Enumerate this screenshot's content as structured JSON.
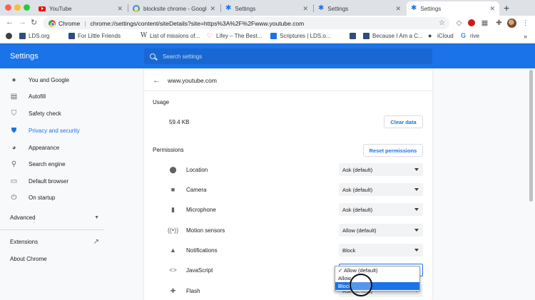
{
  "tabs": [
    {
      "label": "YouTube",
      "icon": "youtube-icon",
      "active": false
    },
    {
      "label": "blocksite chrome - Google S",
      "icon": "google-icon",
      "active": false
    },
    {
      "label": "Settings",
      "icon": "gear-icon",
      "active": false
    },
    {
      "label": "Settings",
      "icon": "gear-icon",
      "active": false
    },
    {
      "label": "Settings",
      "icon": "gear-icon",
      "active": true
    }
  ],
  "toolbar": {
    "scheme_label": "Chrome",
    "url": "chrome://settings/content/siteDetails?site=https%3A%2F%2Fwww.youtube.com"
  },
  "bookmarks": [
    {
      "label": "",
      "icon": "gear-icon"
    },
    {
      "label": "LDS.org",
      "icon": "lds-icon"
    },
    {
      "label": "For Little Friends",
      "icon": "bookmark-icon"
    },
    {
      "label": "List of missions of...",
      "icon": "wikipedia-icon"
    },
    {
      "label": "Lifey – The Best...",
      "icon": "heart-icon"
    },
    {
      "label": "Scriptures | LDS.o...",
      "icon": "lds-icon"
    },
    {
      "label": "",
      "icon": "bookmark-icon"
    },
    {
      "label": "Because I Am a C...",
      "icon": "bookmark-icon"
    },
    {
      "label": "iCloud",
      "icon": "apple-icon"
    },
    {
      "label": "rive",
      "icon": "google-icon"
    }
  ],
  "settings": {
    "title": "Settings",
    "search_placeholder": "Search settings"
  },
  "sidebar": {
    "items": [
      {
        "label": "You and Google",
        "icon": "person-icon",
        "active": false
      },
      {
        "label": "Autofill",
        "icon": "autofill-icon",
        "active": false
      },
      {
        "label": "Safety check",
        "icon": "shield-check-icon",
        "active": false
      },
      {
        "label": "Privacy and security",
        "icon": "shield-icon",
        "active": true
      },
      {
        "label": "Appearance",
        "icon": "palette-icon",
        "active": false
      },
      {
        "label": "Search engine",
        "icon": "search-icon",
        "active": false
      },
      {
        "label": "Default browser",
        "icon": "browser-icon",
        "active": false
      },
      {
        "label": "On startup",
        "icon": "power-icon",
        "active": false
      }
    ],
    "advanced_label": "Advanced",
    "extensions_label": "Extensions",
    "about_label": "About Chrome"
  },
  "site": {
    "name": "www.youtube.com",
    "usage_heading": "Usage",
    "usage_value": "59.4 KB",
    "clear_data_label": "Clear data",
    "permissions_heading": "Permissions",
    "reset_label": "Reset permissions",
    "permissions": [
      {
        "label": "Location",
        "icon": "location-icon",
        "value": "Ask (default)"
      },
      {
        "label": "Camera",
        "icon": "camera-icon",
        "value": "Ask (default)"
      },
      {
        "label": "Microphone",
        "icon": "microphone-icon",
        "value": "Ask (default)"
      },
      {
        "label": "Motion sensors",
        "icon": "motion-sensors-icon",
        "value": "Allow (default)"
      },
      {
        "label": "Notifications",
        "icon": "bell-icon",
        "value": "Block"
      },
      {
        "label": "JavaScript",
        "icon": "code-icon",
        "value": ""
      },
      {
        "label": "Flash",
        "icon": "puzzle-icon",
        "value": "Ask (default)"
      }
    ]
  },
  "dropdown": {
    "options": [
      "✓ Allow (default)",
      "Allow",
      "Block"
    ],
    "highlighted_index": 2
  },
  "colors": {
    "accent": "#1a73e8",
    "header": "#1a73e8"
  }
}
